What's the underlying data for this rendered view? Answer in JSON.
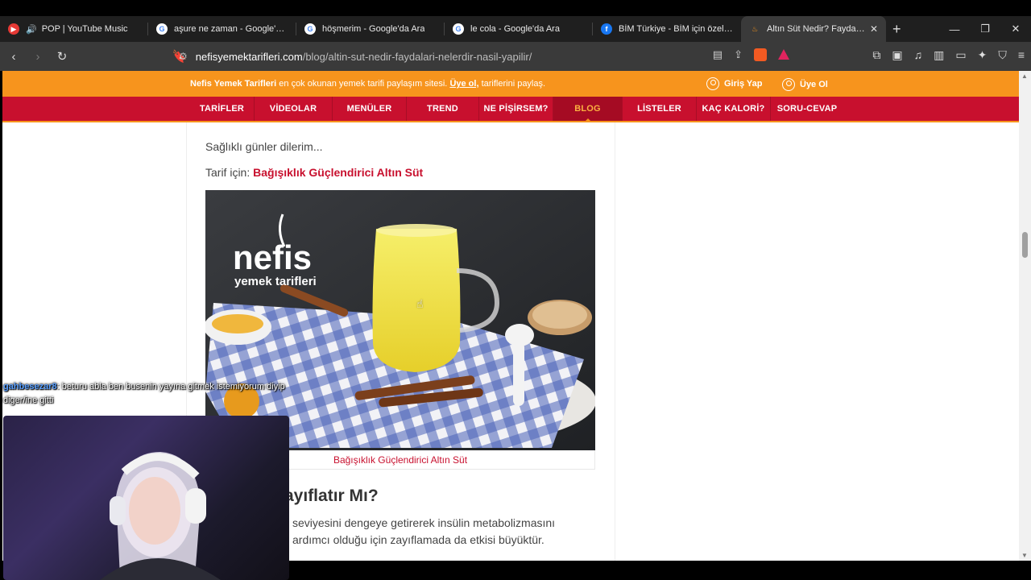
{
  "tabs": [
    {
      "title": "POP | YouTube Music",
      "favicon": "youtube-music-icon",
      "audio": true,
      "active": false
    },
    {
      "title": "aşure ne zaman - Google'da Ara",
      "favicon": "google-icon",
      "active": false
    },
    {
      "title": "höşmerim - Google'da Ara",
      "favicon": "google-icon",
      "active": false
    },
    {
      "title": "le cola - Google'da Ara",
      "favicon": "google-icon",
      "active": false
    },
    {
      "title": "BİM Türkiye - BİM için özel olara",
      "favicon": "facebook-icon",
      "active": false
    },
    {
      "title": "Altın Süt Nedir? Faydaları, N",
      "favicon": "nefis-icon",
      "active": true
    }
  ],
  "address": {
    "domain": "nefisyemektarifleri.com",
    "path": "/blog/altin-sut-nedir-faydalari-nelerdir-nasil-yapilir/"
  },
  "site": {
    "banner": {
      "brand": "Nefis Yemek Tarifleri",
      "text_mid": " en çok okunan yemek tarifi paylaşım sitesi. ",
      "link": "Üye ol,",
      "text_end": " tariflerini paylaş.",
      "login": "Giriş Yap",
      "signup": "Üye Ol"
    },
    "nav": [
      "TARİFLER",
      "VİDEOLAR",
      "MENÜLER",
      "TREND",
      "NE PİŞİRSEM?",
      "BLOG",
      "LİSTELER",
      "KAÇ KALORİ?",
      "SORU-CEVAP"
    ],
    "active_nav": "BLOG"
  },
  "article": {
    "p1": "Sağlıklı günler dilerim...",
    "p2_prefix": "Tarif için: ",
    "p2_link": "Bağışıklık Güçlendirici Altın Süt",
    "image_logo_top": "nefis",
    "image_logo_bottom": "yemek tarifleri",
    "caption": "Bağışıklık Güçlendirici Altın Süt",
    "heading_visible": "ayıflatır Mı?",
    "p3": "seviyesini dengeye getirerek insülin metabolizmasını",
    "p4": "ardımcı olduğu için zayıflamada da etkisi büyüktür."
  },
  "chat": {
    "user": "gahbesezar8",
    "message": ": beturu abla ben busenin yayına gitmek istemiyorum diyip diger/ine gitti"
  },
  "colors": {
    "orange": "#f7941d",
    "red": "#c8102e"
  }
}
